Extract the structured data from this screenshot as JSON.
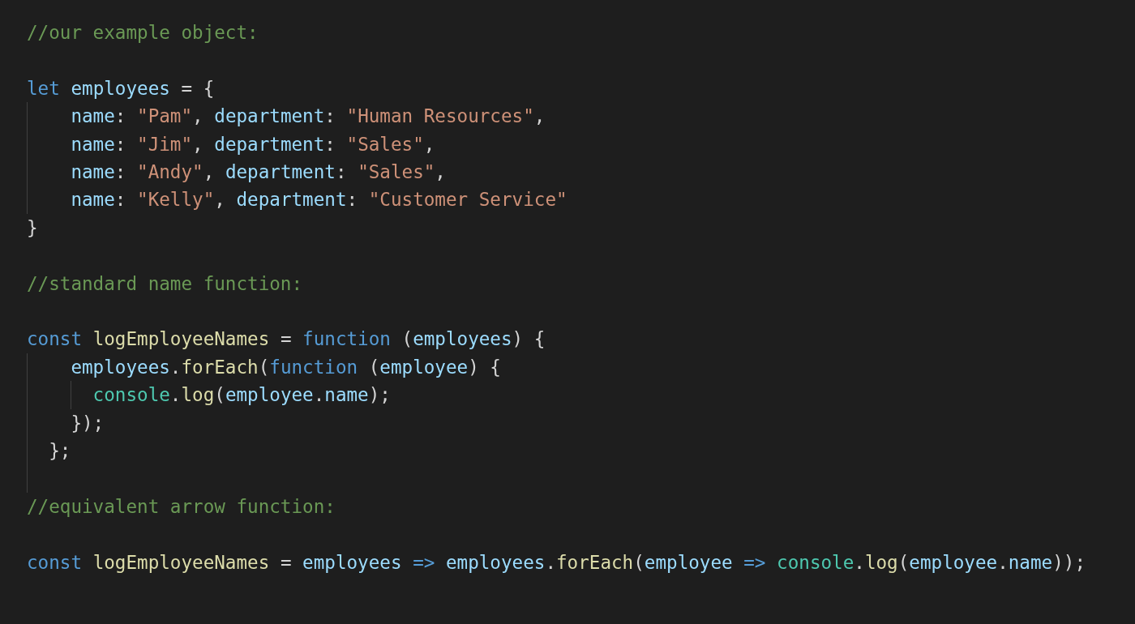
{
  "editor": {
    "lines": [
      {
        "blank_after": true,
        "tokens": [
          {
            "kind": "comment",
            "text": "//our example object:"
          }
        ]
      },
      {
        "tokens": [
          {
            "kind": "keyword",
            "text": "let "
          },
          {
            "kind": "variable",
            "text": "employees"
          },
          {
            "kind": "plain",
            "text": " = {"
          }
        ]
      },
      {
        "tokens": [
          {
            "kind": "variable",
            "text": "    name"
          },
          {
            "kind": "plain",
            "text": ": "
          },
          {
            "kind": "string",
            "text": "\"Pam\""
          },
          {
            "kind": "plain",
            "text": ", "
          },
          {
            "kind": "variable",
            "text": "department"
          },
          {
            "kind": "plain",
            "text": ": "
          },
          {
            "kind": "string",
            "text": "\"Human Resources\""
          },
          {
            "kind": "plain",
            "text": ","
          }
        ]
      },
      {
        "tokens": [
          {
            "kind": "variable",
            "text": "    name"
          },
          {
            "kind": "plain",
            "text": ": "
          },
          {
            "kind": "string",
            "text": "\"Jim\""
          },
          {
            "kind": "plain",
            "text": ", "
          },
          {
            "kind": "variable",
            "text": "department"
          },
          {
            "kind": "plain",
            "text": ": "
          },
          {
            "kind": "string",
            "text": "\"Sales\""
          },
          {
            "kind": "plain",
            "text": ","
          }
        ]
      },
      {
        "tokens": [
          {
            "kind": "variable",
            "text": "    name"
          },
          {
            "kind": "plain",
            "text": ": "
          },
          {
            "kind": "string",
            "text": "\"Andy\""
          },
          {
            "kind": "plain",
            "text": ", "
          },
          {
            "kind": "variable",
            "text": "department"
          },
          {
            "kind": "plain",
            "text": ": "
          },
          {
            "kind": "string",
            "text": "\"Sales\""
          },
          {
            "kind": "plain",
            "text": ","
          }
        ]
      },
      {
        "tokens": [
          {
            "kind": "variable",
            "text": "    name"
          },
          {
            "kind": "plain",
            "text": ": "
          },
          {
            "kind": "string",
            "text": "\"Kelly\""
          },
          {
            "kind": "plain",
            "text": ", "
          },
          {
            "kind": "variable",
            "text": "department"
          },
          {
            "kind": "plain",
            "text": ": "
          },
          {
            "kind": "string",
            "text": "\"Customer Service\""
          }
        ]
      },
      {
        "blank_after": true,
        "tokens": [
          {
            "kind": "plain",
            "text": "}"
          }
        ]
      },
      {
        "blank_after": true,
        "tokens": [
          {
            "kind": "comment",
            "text": "//standard name function:"
          }
        ]
      },
      {
        "tokens": [
          {
            "kind": "keyword",
            "text": "const "
          },
          {
            "kind": "function",
            "text": "logEmployeeNames"
          },
          {
            "kind": "plain",
            "text": " = "
          },
          {
            "kind": "keyword",
            "text": "function"
          },
          {
            "kind": "plain",
            "text": " ("
          },
          {
            "kind": "variable",
            "text": "employees"
          },
          {
            "kind": "plain",
            "text": ") {"
          }
        ]
      },
      {
        "tokens": [
          {
            "kind": "variable",
            "text": "    employees"
          },
          {
            "kind": "plain",
            "text": "."
          },
          {
            "kind": "function",
            "text": "forEach"
          },
          {
            "kind": "plain",
            "text": "("
          },
          {
            "kind": "keyword",
            "text": "function"
          },
          {
            "kind": "plain",
            "text": " ("
          },
          {
            "kind": "variable",
            "text": "employee"
          },
          {
            "kind": "plain",
            "text": ") {"
          }
        ]
      },
      {
        "tokens": [
          {
            "kind": "class",
            "text": "      console"
          },
          {
            "kind": "plain",
            "text": "."
          },
          {
            "kind": "function",
            "text": "log"
          },
          {
            "kind": "plain",
            "text": "("
          },
          {
            "kind": "variable",
            "text": "employee"
          },
          {
            "kind": "plain",
            "text": "."
          },
          {
            "kind": "variable",
            "text": "name"
          },
          {
            "kind": "plain",
            "text": ");"
          }
        ]
      },
      {
        "tokens": [
          {
            "kind": "plain",
            "text": "    });"
          }
        ]
      },
      {
        "blank_after": true,
        "tokens": [
          {
            "kind": "plain",
            "text": "  };"
          }
        ]
      },
      {
        "blank_after": true,
        "tokens": [
          {
            "kind": "comment",
            "text": "//equivalent arrow function:"
          }
        ]
      },
      {
        "tokens": [
          {
            "kind": "keyword",
            "text": "const "
          },
          {
            "kind": "function",
            "text": "logEmployeeNames"
          },
          {
            "kind": "plain",
            "text": " = "
          },
          {
            "kind": "variable",
            "text": "employees"
          },
          {
            "kind": "keyword",
            "text": " => "
          },
          {
            "kind": "variable",
            "text": "employees"
          },
          {
            "kind": "plain",
            "text": "."
          },
          {
            "kind": "function",
            "text": "forEach"
          },
          {
            "kind": "plain",
            "text": "("
          },
          {
            "kind": "variable",
            "text": "employee"
          },
          {
            "kind": "keyword",
            "text": " => "
          },
          {
            "kind": "class",
            "text": "console"
          },
          {
            "kind": "plain",
            "text": "."
          },
          {
            "kind": "function",
            "text": "log"
          },
          {
            "kind": "plain",
            "text": "("
          },
          {
            "kind": "variable",
            "text": "employee"
          },
          {
            "kind": "plain",
            "text": "."
          },
          {
            "kind": "variable",
            "text": "name"
          },
          {
            "kind": "plain",
            "text": "));"
          }
        ]
      }
    ]
  }
}
